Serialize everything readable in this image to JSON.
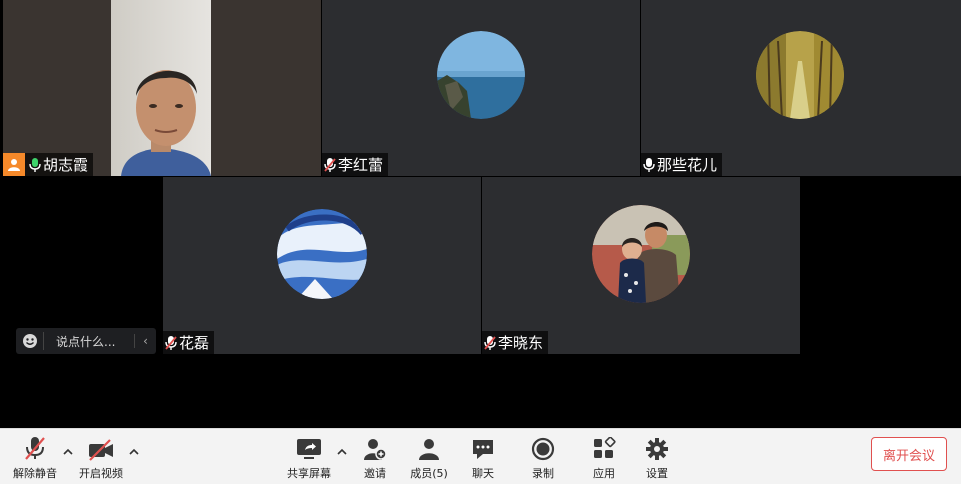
{
  "participants": [
    {
      "name": "胡志霞",
      "is_host": true,
      "muted": false,
      "video_on": true,
      "speaking": true
    },
    {
      "name": "李红蕾",
      "muted": true,
      "video_on": false,
      "avatar": "seaside-cliff"
    },
    {
      "name": "那些花儿",
      "muted": false,
      "video_on": false,
      "avatar": "autumn-tree-path"
    },
    {
      "name": "花磊",
      "muted": true,
      "video_on": false,
      "avatar": "anime-sky-clouds"
    },
    {
      "name": "李晓东",
      "muted": true,
      "video_on": false,
      "avatar": "father-and-child"
    }
  ],
  "chat": {
    "placeholder": "说点什么..."
  },
  "toolbar": {
    "mute_label": "解除静音",
    "video_label": "开启视频",
    "share_label": "共享屏幕",
    "invite_label": "邀请",
    "members_label": "成员(5)",
    "chat_label": "聊天",
    "record_label": "录制",
    "apps_label": "应用",
    "settings_label": "设置",
    "leave_label": "离开会议"
  },
  "colors": {
    "active_speaker": "#2bd16a",
    "host_badge": "#f5892a",
    "leave": "#e0504f",
    "mute_slash": "#e0504f"
  }
}
